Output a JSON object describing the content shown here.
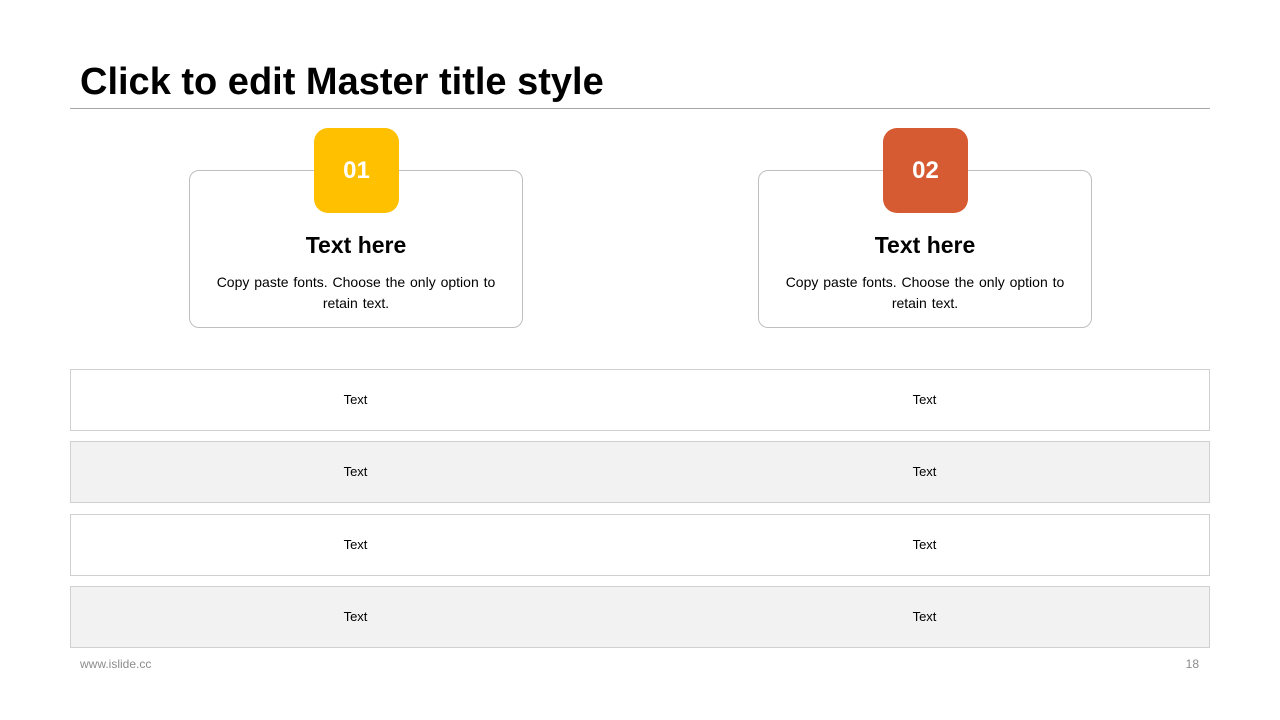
{
  "title": "Click to edit Master title style",
  "colors": {
    "badge_1": "#FFC000",
    "badge_2": "#D65B33",
    "row_alt": "#F2F2F2",
    "border": "#BFBFBF"
  },
  "cards": [
    {
      "number": "01",
      "heading": "Text here",
      "body": "Copy paste fonts. Choose the only option to retain text."
    },
    {
      "number": "02",
      "heading": "Text here",
      "body": "Copy paste fonts. Choose the only option to retain text."
    }
  ],
  "table": {
    "rows": [
      [
        "Text",
        "Text"
      ],
      [
        "Text",
        "Text"
      ],
      [
        "Text",
        "Text"
      ],
      [
        "Text",
        "Text"
      ]
    ]
  },
  "footer": {
    "url": "www.islide.cc",
    "page": "18"
  }
}
